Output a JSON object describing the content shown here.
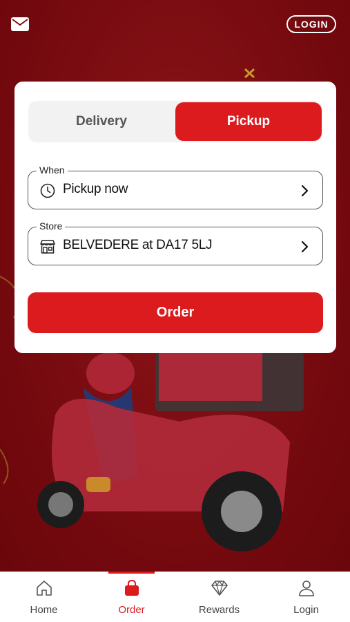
{
  "header": {
    "login_label": "LOGIN",
    "mail_icon": "mail-icon"
  },
  "order_card": {
    "tabs": [
      {
        "label": "Delivery",
        "selected": false
      },
      {
        "label": "Pickup",
        "selected": true
      }
    ],
    "when": {
      "legend": "When",
      "value": "Pickup now",
      "icon": "clock-icon"
    },
    "store": {
      "legend": "Store",
      "value": "BELVEDERE at DA17 5LJ",
      "icon": "store-icon"
    },
    "order_label": "Order"
  },
  "bottom_nav": {
    "items": [
      {
        "label": "Home",
        "icon": "home-icon",
        "active": false
      },
      {
        "label": "Order",
        "icon": "shopping-bag-icon",
        "active": true
      },
      {
        "label": "Rewards",
        "icon": "diamond-icon",
        "active": false
      },
      {
        "label": "Login",
        "icon": "user-icon",
        "active": false
      }
    ]
  },
  "colors": {
    "brand_red": "#dc1b1f",
    "background": "#7a0f14"
  }
}
